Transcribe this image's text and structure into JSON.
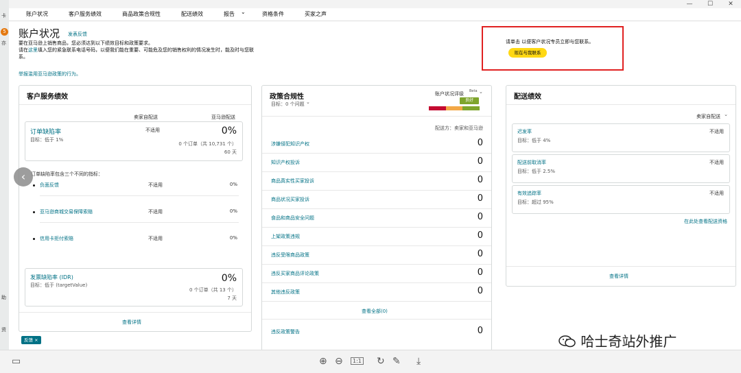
{
  "window": {
    "minimize": "—",
    "maximize": "☐",
    "close": "✕"
  },
  "left_strip": {
    "badge": "5",
    "labels": [
      "卡",
      "亦",
      "助",
      "资"
    ]
  },
  "nav": {
    "items": [
      "账户状况",
      "客户服务绩效",
      "商品政策合规性",
      "配送绩效",
      "报告",
      "资格条件",
      "买家之声"
    ],
    "report_caret": "⌄"
  },
  "header": {
    "title": "账户状况",
    "feedback": "发表反馈",
    "intro_line1": "要在亚马逊上销售商品，您必须达到以下绩效目标和政策要求。",
    "intro_line2_pre": "请在",
    "intro_line2_link": "这里",
    "intro_line2_post": "填入您的紧急联系电话号码，以便我们能在重要、可能危及您的销售权利的情况发生时，能及时与您联系。",
    "report_link": "举报滥用亚马逊政策的行为。"
  },
  "contact": {
    "text": "请单击 以便客户状况专员立即与您联系。",
    "button": "现在与我联系"
  },
  "customer_service": {
    "title": "客户服务绩效",
    "col_seller": "卖家自配送",
    "col_amazon": "亚马逊配送",
    "odr": {
      "label": "订单缺陷率",
      "target": "目标：低于 1%",
      "seller": "不适用",
      "value": "0%",
      "orders": "0 个订单（共 10,731 个）",
      "days": "60 天"
    },
    "intro": "订单缺陷率包含三个不同的指标：",
    "metrics": [
      {
        "label": "负面反馈",
        "seller": "不适用",
        "value": "0%"
      },
      {
        "label": "亚马逊商城交易保障索赔",
        "seller": "不适用",
        "value": "0%"
      },
      {
        "label": "信用卡拒付索赔",
        "seller": "不适用",
        "value": "0%"
      }
    ],
    "idr": {
      "label": "发票缺陷率 (IDR)",
      "target": "目标：低于 (targetValue)",
      "value": "0%",
      "orders": "0 个订单（共 13 个）",
      "days": "7 天"
    },
    "view_details": "查看详情"
  },
  "policy": {
    "title": "政策合规性",
    "target": "目标：0 个问题",
    "target_caret": "⌄",
    "rating_label": "账户状况评级",
    "beta": "Beta",
    "rating_caret": "⌄",
    "rating_value": "良好",
    "rating_colors": [
      "#c40b31",
      "#f3a847",
      "#7fa52d"
    ],
    "fulfilled_by": "配送方：卖家和亚马逊",
    "rows": [
      {
        "label": "涉嫌侵犯知识产权",
        "value": "0"
      },
      {
        "label": "知识产权投诉",
        "value": "0"
      },
      {
        "label": "商品真实性买家投诉",
        "value": "0"
      },
      {
        "label": "商品状况买家投诉",
        "value": "0"
      },
      {
        "label": "食品和商品安全问题",
        "value": "0"
      },
      {
        "label": "上架政策违规",
        "value": "0"
      },
      {
        "label": "违反受限商品政策",
        "value": "0"
      },
      {
        "label": "违反买家商品评论政策",
        "value": "0"
      },
      {
        "label": "其他违反政策",
        "value": "0"
      }
    ],
    "view_all": "查看全部(0)",
    "warning_label": "违反政策警告",
    "warning_value": "0"
  },
  "shipping": {
    "title": "配送绩效",
    "seller_label": "卖家自配送",
    "seller_caret": "⌄",
    "metrics": [
      {
        "label": "迟发率",
        "target": "目标：低于 4%",
        "value": "不适用"
      },
      {
        "label": "配送前取消率",
        "target": "目标：低于 2.5%",
        "value": "不适用"
      },
      {
        "label": "有效追踪率",
        "target": "目标：超过 95%",
        "value": "不适用"
      }
    ],
    "eligibility_link": "在此处查看配送资格",
    "view_details": "查看详情"
  },
  "chip": {
    "label": "反馈",
    "close": "×"
  },
  "carousel": {
    "prev": "‹"
  },
  "watermark": {
    "text": "哈士奇站外推广"
  },
  "toolbar": {
    "zoom_in": "⊕",
    "zoom_out": "⊖",
    "actual_size": "1:1",
    "rotate": "↻",
    "edit": "✎",
    "download": "⤓",
    "panel": "▭"
  }
}
